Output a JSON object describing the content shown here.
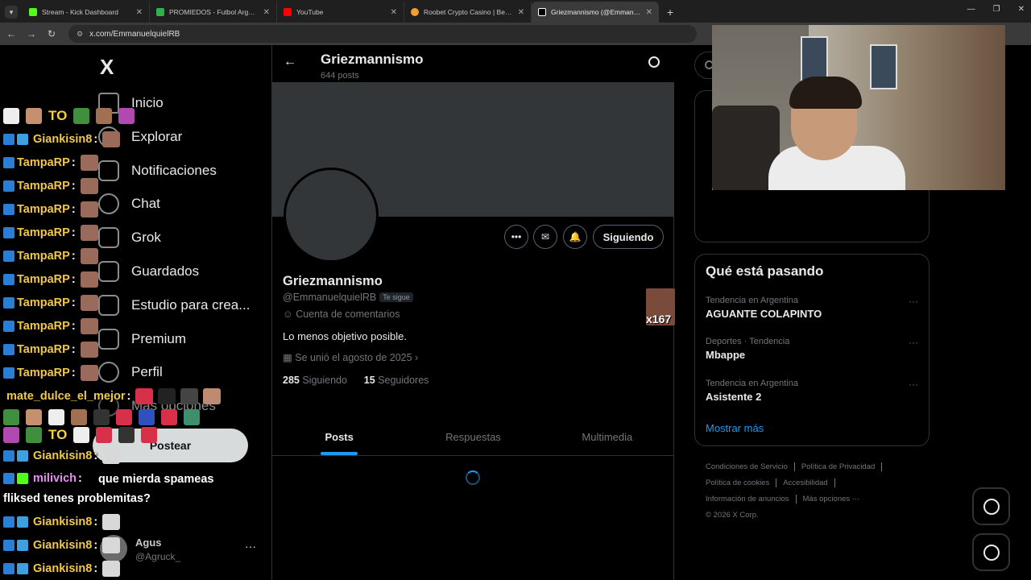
{
  "browser": {
    "tabs": [
      {
        "title": "Stream - Kick Dashboard",
        "color": "#53fc18",
        "active": false
      },
      {
        "title": "PROMIEDOS - Futbol Argentino",
        "color": "#2fb24c",
        "active": false
      },
      {
        "title": "YouTube",
        "color": "#ff0000",
        "active": false
      },
      {
        "title": "Roobet Crypto Casino | Best Bitc",
        "color": "#f0a030",
        "active": false
      },
      {
        "title": "Griezmannismo (@Emmanuelq",
        "color": "#ffffff",
        "active": true
      }
    ],
    "url": "x.com/EmmanuelquielRB"
  },
  "sidebar": {
    "logo": "X",
    "items": [
      {
        "label": "Inicio",
        "icon": "home-icon"
      },
      {
        "label": "Explorar",
        "icon": "search-icon"
      },
      {
        "label": "Notificaciones",
        "icon": "bell-icon"
      },
      {
        "label": "Chat",
        "icon": "chat-icon"
      },
      {
        "label": "Grok",
        "icon": "grok-icon"
      },
      {
        "label": "Guardados",
        "icon": "bookmark-icon"
      },
      {
        "label": "Estudio para crea...",
        "icon": "studio-icon"
      },
      {
        "label": "Premium",
        "icon": "x-premium-icon"
      },
      {
        "label": "Perfil",
        "icon": "profile-icon"
      },
      {
        "label": "Más opciones",
        "icon": "more-icon"
      }
    ],
    "post_label": "Postear",
    "account": {
      "name": "Agus",
      "handle": "@Agruck_"
    }
  },
  "chat": {
    "lines": [
      {
        "user": "Giankisin8",
        "badges": 2
      },
      {
        "user": "TampaRP",
        "badges": 1
      },
      {
        "user": "TampaRP",
        "badges": 1
      },
      {
        "user": "TampaRP",
        "badges": 1
      },
      {
        "user": "TampaRP",
        "badges": 1
      },
      {
        "user": "TampaRP",
        "badges": 1
      },
      {
        "user": "TampaRP",
        "badges": 1
      },
      {
        "user": "TampaRP",
        "badges": 1
      },
      {
        "user": "TampaRP",
        "badges": 1
      },
      {
        "user": "TampaRP",
        "badges": 1
      },
      {
        "user": "TampaRP",
        "badges": 1
      }
    ],
    "mate_user": "mate_dulce_el_mejor",
    "gk_after_emotes": "Giankisin8",
    "milivich_user": "milivich",
    "milivich_msg": "que mierda spameas fliksed tenes problemitas?",
    "tail_lines": [
      "Giankisin8",
      "Giankisin8",
      "Giankisin8"
    ],
    "inline_word": "TO",
    "name_colors": {
      "giankisin": "#f2c84b",
      "tamparp": "#f2c84b",
      "mate": "#f2c84b",
      "milivich": "#e58ff0"
    }
  },
  "profile": {
    "title": "Griezmannismo",
    "posts_count": "644 posts",
    "name": "Griezmannismo",
    "handle": "@EmmanuelquielRB",
    "follows_you": "Te sigue",
    "category": "Cuenta de comentarios",
    "bio": "Lo menos objetivo posible.",
    "joined": "Se unió el agosto de 2025",
    "following_count": "285",
    "following_label": "Siguiendo",
    "followers_count": "15",
    "followers_label": "Seguidores",
    "follow_button": "Siguiendo",
    "tabs": [
      "Posts",
      "Respuestas",
      "Multimedia"
    ],
    "overlay_text": "x167"
  },
  "trends": {
    "title": "Qué está pasando",
    "items": [
      {
        "meta": "Tendencia en Argentina",
        "name": "AGUANTE COLAPINTO"
      },
      {
        "meta": "Deportes · Tendencia",
        "name": "Mbappe"
      },
      {
        "meta": "Tendencia en Argentina",
        "name": "Asistente 2"
      }
    ],
    "show_more": "Mostrar más"
  },
  "footer": {
    "links": [
      "Condiciones de Servicio",
      "Política de Privacidad",
      "Política de cookies",
      "Accesibilidad",
      "Información de anuncios",
      "Más opciones ···"
    ],
    "copyright": "© 2026 X Corp."
  },
  "colors": {
    "accent": "#1d9bf0",
    "bg": "#000000",
    "border": "#2f3336"
  }
}
